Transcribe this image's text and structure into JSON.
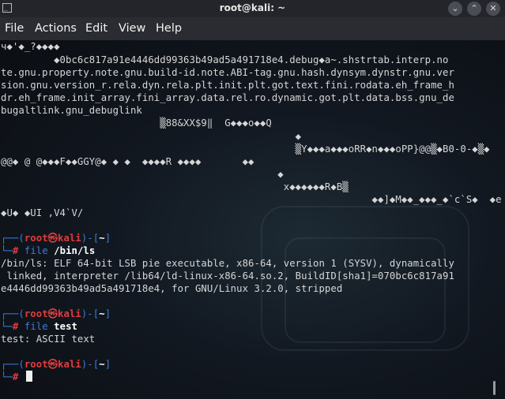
{
  "window": {
    "title": "root@kali: ~",
    "app_icon": "terminal-icon",
    "controls": [
      "minimize-icon",
      "maximize-icon",
      "close-icon"
    ],
    "control_glyphs": [
      "⌄",
      "⌃",
      "✕"
    ]
  },
  "menu": [
    "File",
    "Actions",
    "Edit",
    "View",
    "Help"
  ],
  "garbage": [
    "ч◆'◆_?◆◆◆◆",
    "         ◆0bc6c817a91e4446dd99363b49ad5a491718e4.debug◆a~.shstrtab.interp.no",
    "te.gnu.property.note.gnu.build-id.note.ABI-tag.gnu.hash.dynsym.dynstr.gnu.ver",
    "sion.gnu.version_r.rela.dyn.rela.plt.init.plt.got.text.fini.rodata.eh_frame_h",
    "dr.eh_frame.init_array.fini_array.data.rel.ro.dynamic.got.plt.data.bss.gnu_de",
    "bugaltlink.gnu_debuglink",
    "                           ▒88&XX$9‖  G◆◆◆o◆◆Q",
    "                                                  ◆",
    "                                                  ▒Y◆◆◆a◆◆◆oRR◆n◆◆◆oPP}@@▒◆B0-0-◆▒◆",
    "@@◆ @ @◆◆◆F◆◆GGY@◆ ◆ ◆  ◆◆◆◆R ◆◆◆◆       ◆◆",
    "                                               ◆",
    "                                                x◆◆◆◆◆◆R◆B▒",
    "                                                               ◆◆]◆M◆◆_◆◆◆_◆`c`S◆  ◆e",
    "",
    "◆U◆ ◆UI ,V4`V/"
  ],
  "prompt": {
    "user": "root",
    "at": "㉿",
    "host": "kali",
    "cwd": "~",
    "symbol": "#"
  },
  "commands": [
    {
      "cmd": "file",
      "arg": "/bin/ls",
      "output": [
        "/bin/ls: ELF 64-bit LSB pie executable, x86-64, version 1 (SYSV), dynamically",
        " linked, interpreter /lib64/ld-linux-x86-64.so.2, BuildID[sha1]=070bc6c817a91",
        "e4446dd99363b49ad5a491718e4, for GNU/Linux 3.2.0, stripped"
      ]
    },
    {
      "cmd": "file",
      "arg": "test",
      "output": [
        "test: ASCII text"
      ]
    }
  ]
}
